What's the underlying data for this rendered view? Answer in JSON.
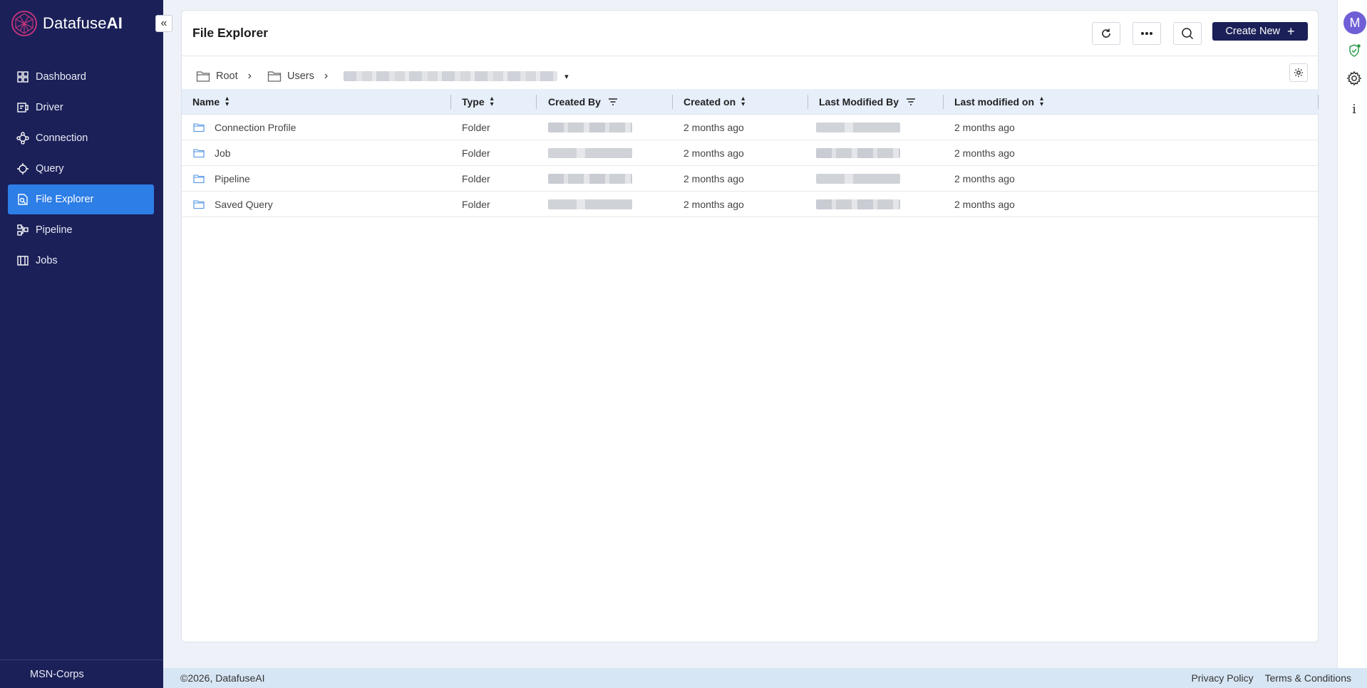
{
  "brand": {
    "name_light": "Datafuse",
    "name_bold": "AI"
  },
  "sidebar": {
    "items": [
      {
        "label": "Dashboard",
        "icon": "dashboard-icon"
      },
      {
        "label": "Driver",
        "icon": "driver-icon"
      },
      {
        "label": "Connection",
        "icon": "connection-icon"
      },
      {
        "label": "Query",
        "icon": "query-icon"
      },
      {
        "label": "File Explorer",
        "icon": "file-explorer-icon",
        "active": true
      },
      {
        "label": "Pipeline",
        "icon": "pipeline-icon"
      },
      {
        "label": "Jobs",
        "icon": "jobs-icon"
      }
    ],
    "org": "MSN-Corps",
    "collapse_icon": "«"
  },
  "header": {
    "title": "File Explorer",
    "create_label": "Create New",
    "create_icon": "+"
  },
  "breadcrumb": {
    "root": "Root",
    "users": "Users",
    "separator": "›",
    "caret": "▾"
  },
  "table": {
    "columns": {
      "name": "Name",
      "type": "Type",
      "created_by": "Created By",
      "created_on": "Created on",
      "last_modified_by": "Last Modified By",
      "last_modified_on": "Last modified on"
    },
    "rows": [
      {
        "name": "Connection Profile",
        "type": "Folder",
        "created_on": "2 months ago",
        "last_modified_on": "2 months ago"
      },
      {
        "name": "Job",
        "type": "Folder",
        "created_on": "2 months ago",
        "last_modified_on": "2 months ago"
      },
      {
        "name": "Pipeline",
        "type": "Folder",
        "created_on": "2 months ago",
        "last_modified_on": "2 months ago"
      },
      {
        "name": "Saved Query",
        "type": "Folder",
        "created_on": "2 months ago",
        "last_modified_on": "2 months ago"
      }
    ]
  },
  "rail": {
    "avatar_initial": "M",
    "info_glyph": "i"
  },
  "footer": {
    "copyright": "©2026, DatafuseAI",
    "privacy": "Privacy Policy",
    "terms": "Terms & Conditions"
  },
  "colors": {
    "sidebar_bg": "#1b2058",
    "active": "#2d7ee6",
    "header_bg": "#e7effb",
    "footer_bg": "#d7e6f4"
  }
}
